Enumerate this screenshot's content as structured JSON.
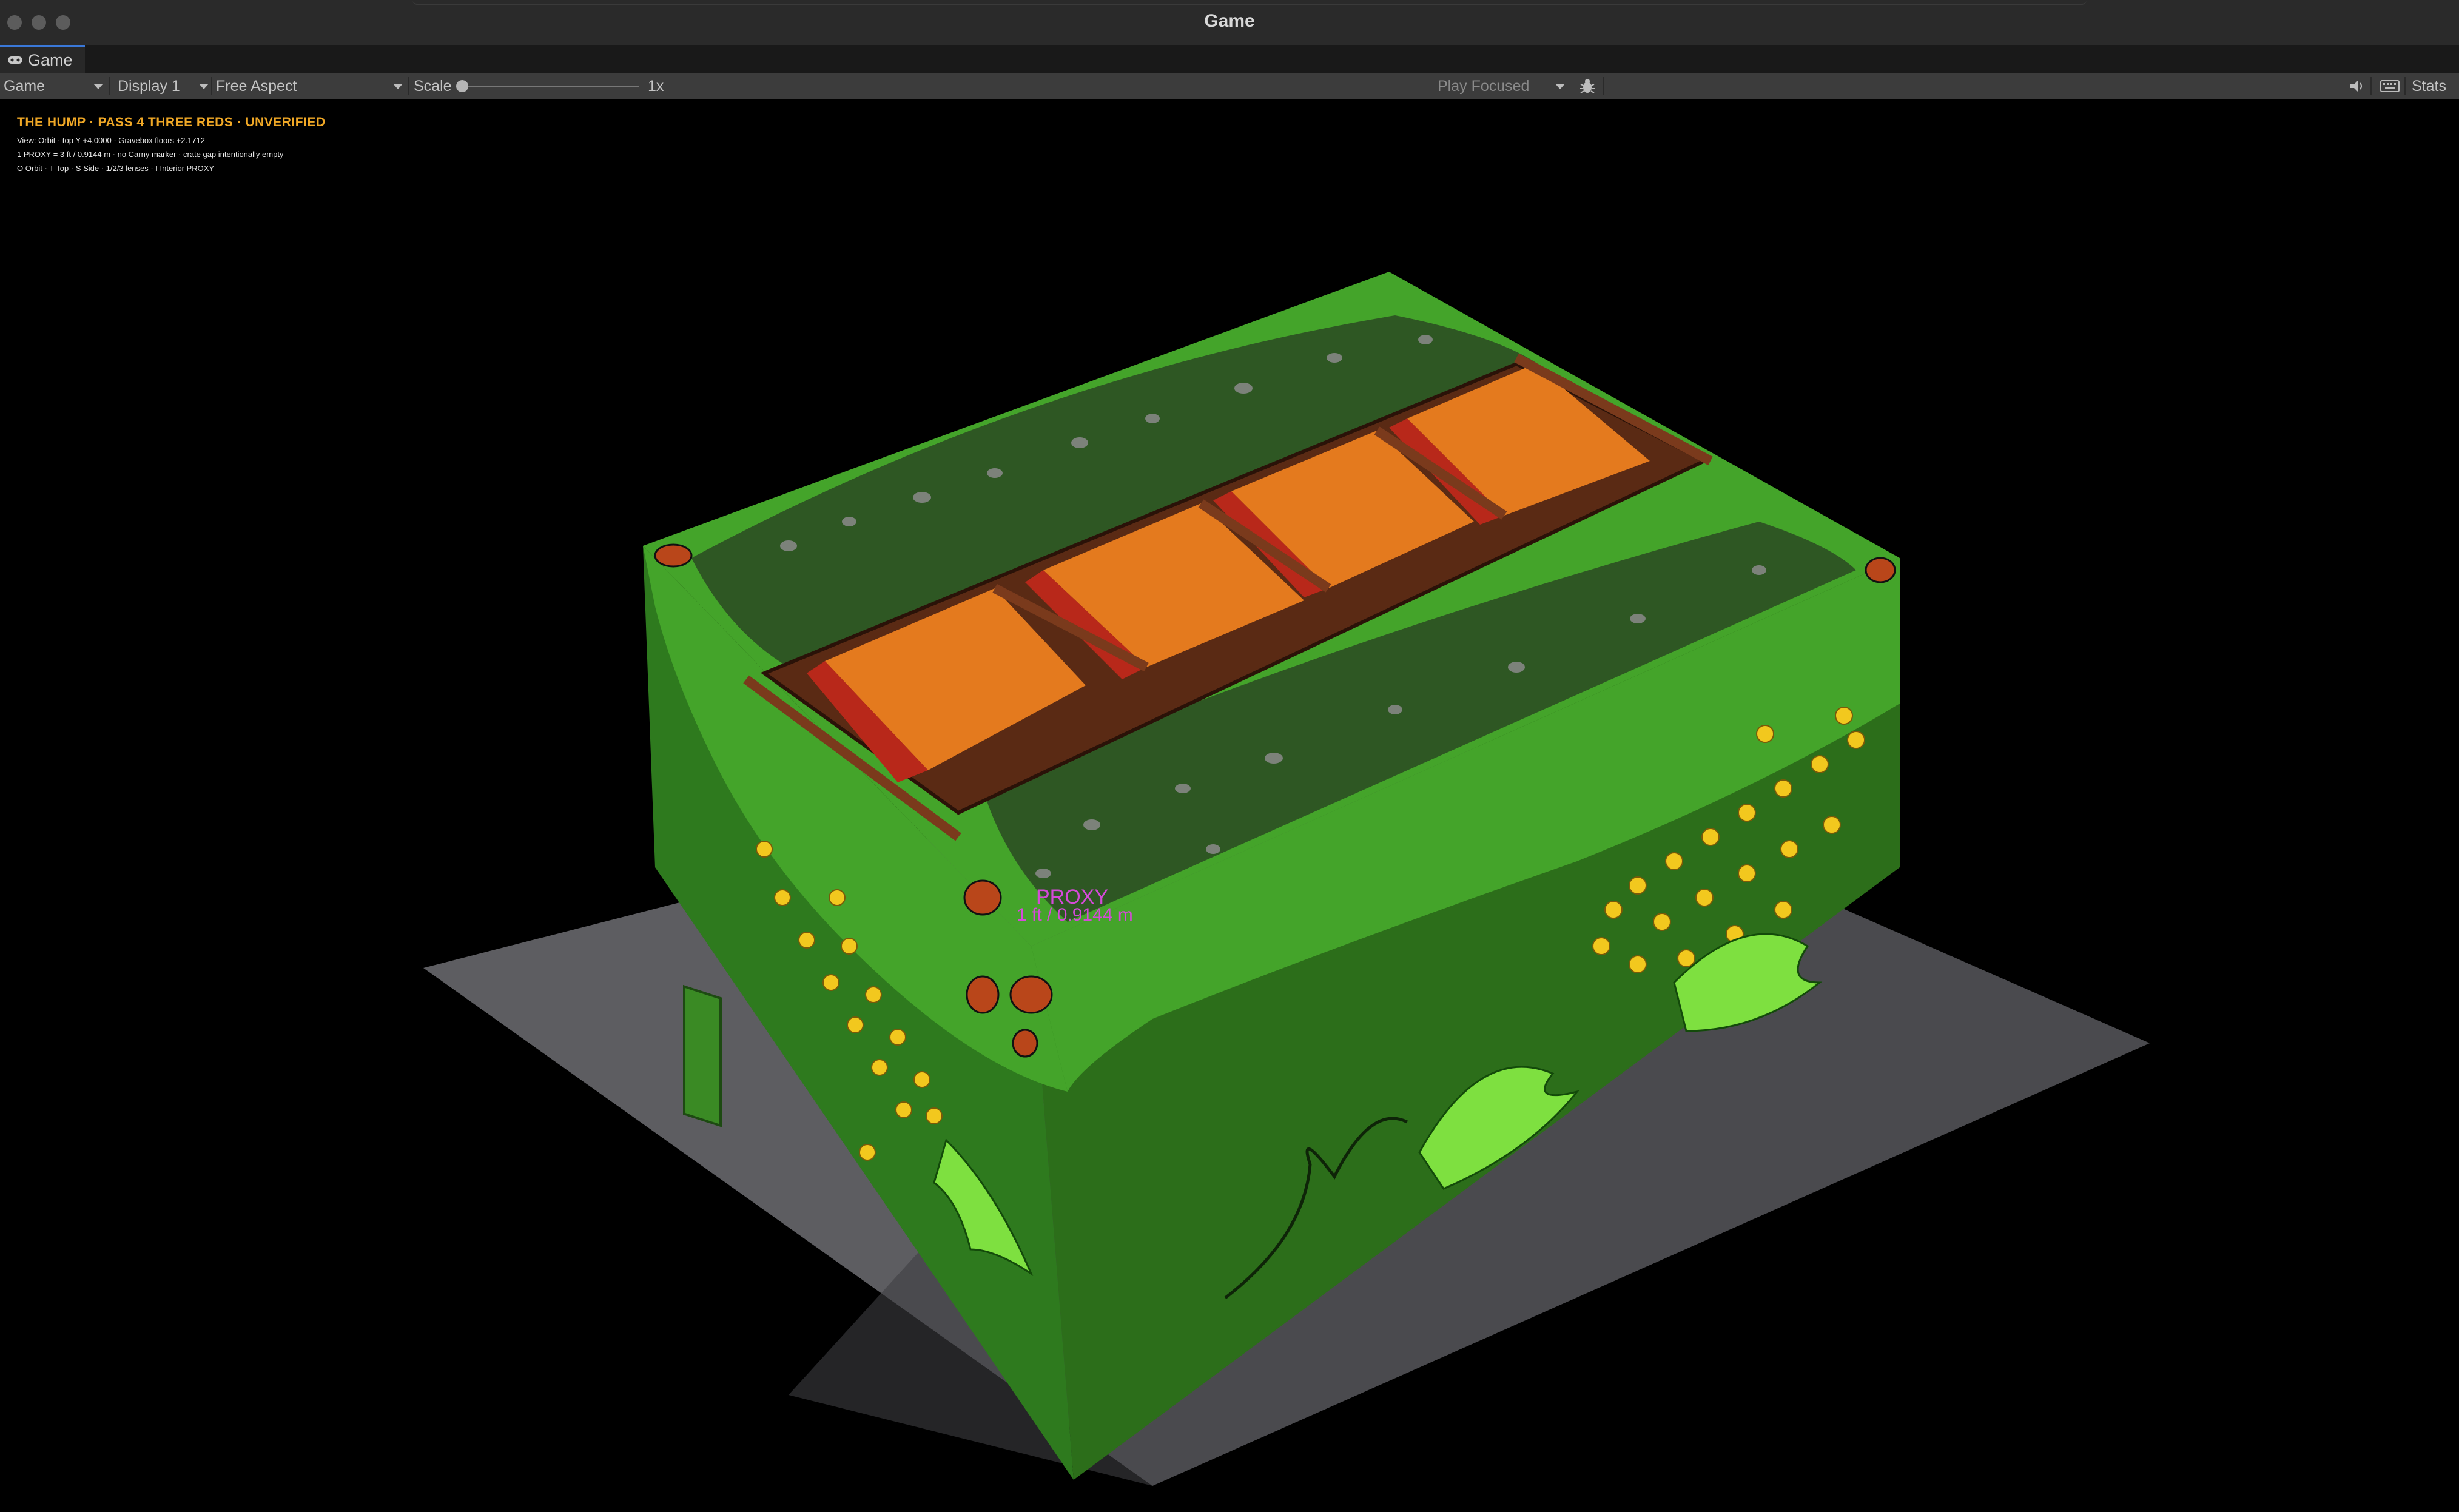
{
  "window": {
    "title": "Game"
  },
  "tab": {
    "label": "Game"
  },
  "toolbar": {
    "mode": "Game",
    "display": "Display 1",
    "aspect": "Free Aspect",
    "scale_label": "Scale",
    "scale_value": "1x",
    "play_mode": "Play Focused",
    "stats": "Stats"
  },
  "hud": {
    "title": "THE HUMP · PASS 4 THREE REDS · UNVERIFIED",
    "line1": "View: Orbit · top Y +4.0000 · Gravebox floors +2.1712",
    "line2": "1 PROXY = 3 ft / 0.9144 m · no Carny marker · crate gap intentionally empty",
    "line3": "O Orbit · T Top · S Side · 1/2/3 lenses · I Interior PROXY"
  },
  "scene": {
    "proxy_label": "PROXY",
    "proxy_measure": "1 ft / 0.9144 m",
    "colors": {
      "ground": "#5a5a5e",
      "grass_top": "#48a82a",
      "grass_dark": "#2a6a1a",
      "pit_orange": "#e47a1e",
      "pit_red": "#b8281a",
      "wood": "#7a3a1c",
      "flower": "#f2c81e"
    }
  }
}
